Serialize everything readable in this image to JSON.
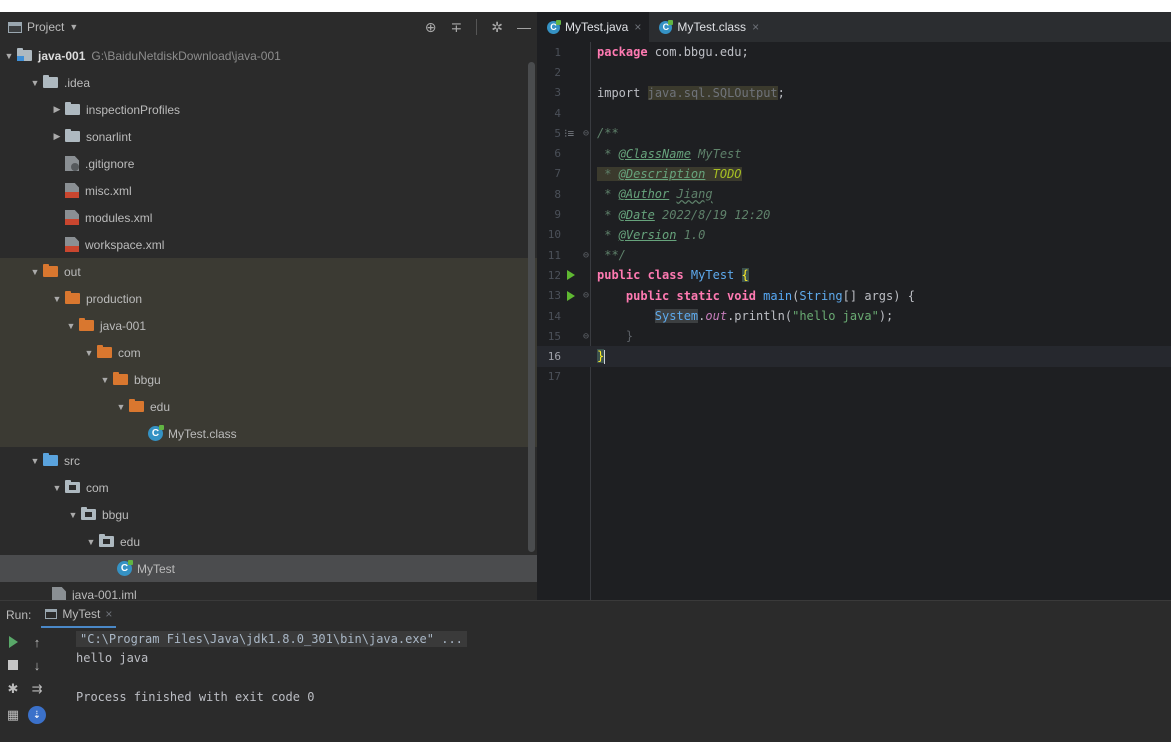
{
  "project_panel": {
    "title": "Project",
    "tools": [
      "crosshair-icon",
      "collapse-icon",
      "gear-icon",
      "minimize-icon"
    ],
    "tree": [
      {
        "label": "java-001",
        "path": "G:\\BaiduNetdiskDownload\\java-001",
        "kind": "module",
        "expanded": true,
        "depth": 0
      },
      {
        "label": ".idea",
        "kind": "folder-gray",
        "expanded": true,
        "depth": 1
      },
      {
        "label": "inspectionProfiles",
        "kind": "folder-gray",
        "expanded": false,
        "depth": 2
      },
      {
        "label": "sonarlint",
        "kind": "folder-gray",
        "expanded": false,
        "depth": 2
      },
      {
        "label": ".gitignore",
        "kind": "file-git",
        "depth": 2
      },
      {
        "label": "misc.xml",
        "kind": "file-xml",
        "depth": 2
      },
      {
        "label": "modules.xml",
        "kind": "file-xml",
        "depth": 2
      },
      {
        "label": "workspace.xml",
        "kind": "file-xml",
        "depth": 2
      },
      {
        "label": "out",
        "kind": "folder-orange",
        "expanded": true,
        "depth": 1
      },
      {
        "label": "production",
        "kind": "folder-orange",
        "expanded": true,
        "depth": 2
      },
      {
        "label": "java-001",
        "kind": "folder-orange",
        "expanded": true,
        "depth": 3
      },
      {
        "label": "com",
        "kind": "folder-orange",
        "expanded": true,
        "depth": 4
      },
      {
        "label": "bbgu",
        "kind": "folder-orange",
        "expanded": true,
        "depth": 5
      },
      {
        "label": "edu",
        "kind": "folder-orange",
        "expanded": true,
        "depth": 6
      },
      {
        "label": "MyTest.class",
        "kind": "class",
        "depth": 7
      },
      {
        "label": "src",
        "kind": "folder-blue",
        "expanded": true,
        "depth": 1
      },
      {
        "label": "com",
        "kind": "package",
        "expanded": true,
        "depth": 2
      },
      {
        "label": "bbgu",
        "kind": "package",
        "expanded": true,
        "depth": 3
      },
      {
        "label": "edu",
        "kind": "package",
        "expanded": true,
        "depth": 4
      },
      {
        "label": "MyTest",
        "kind": "class",
        "depth": 5,
        "selected": true
      },
      {
        "label": "java-001.iml",
        "kind": "file-iml",
        "depth": 1
      }
    ]
  },
  "editor": {
    "tabs": [
      {
        "label": "MyTest.java",
        "active": true
      },
      {
        "label": "MyTest.class",
        "active": false
      }
    ],
    "line_numbers": [
      "1",
      "2",
      "3",
      "4",
      "5",
      "6",
      "7",
      "8",
      "9",
      "10",
      "11",
      "12",
      "13",
      "14",
      "15",
      "16",
      "17"
    ],
    "current_line": 16,
    "code": {
      "l1_kw": "package",
      "l1_rest": " com.bbgu.edu;",
      "l3_kw": "import",
      "l3_import": "java.sql.SQLOutput",
      "l3_end": ";",
      "l5": "/**",
      "l6_star": " * ",
      "l6_tag": "@ClassName",
      "l6_val": " MyTest",
      "l7_star": " * ",
      "l7_tag": "@Description",
      "l7_val": " TODO",
      "l8_star": " * ",
      "l8_tag": "@Author",
      "l8_val": "Jiang",
      "l9_star": " * ",
      "l9_tag": "@Date",
      "l9_val": " 2022/8/19 12:20",
      "l10_star": " * ",
      "l10_tag": "@Version",
      "l10_val": " 1.0",
      "l11": " **/",
      "l12_kw": "public class",
      "l12_name": " MyTest ",
      "l12_brace": "{",
      "l13_indent": "    ",
      "l13_kw": "public static void",
      "l13_method": " main",
      "l13_p1": "(",
      "l13_type": "String",
      "l13_p2": "[] args) {",
      "l14_indent": "        ",
      "l14_cls": "System",
      "l14_dot": ".",
      "l14_field": "out",
      "l14_call": ".println(",
      "l14_str": "\"hello java\"",
      "l14_end": ");",
      "l15": "    }",
      "l16": "}"
    }
  },
  "run_panel": {
    "label": "Run:",
    "tab": "MyTest",
    "console": {
      "command": "\"C:\\Program Files\\Java\\jdk1.8.0_301\\bin\\java.exe\" ...",
      "output": "hello java",
      "exit": "Process finished with exit code 0"
    },
    "tools": [
      "run-icon",
      "up-arrow-icon",
      "stop-icon",
      "down-arrow-icon",
      "debug-icon",
      "wrap-icon",
      "layout-icon",
      "scroll-end-icon"
    ]
  },
  "colors": {
    "panel_bg": "#2b2b2b",
    "editor_bg": "#1e1f22",
    "keyword": "#cf8e6d",
    "string": "#6aab73",
    "doc": "#5f826b",
    "accent": "#3592c4"
  }
}
